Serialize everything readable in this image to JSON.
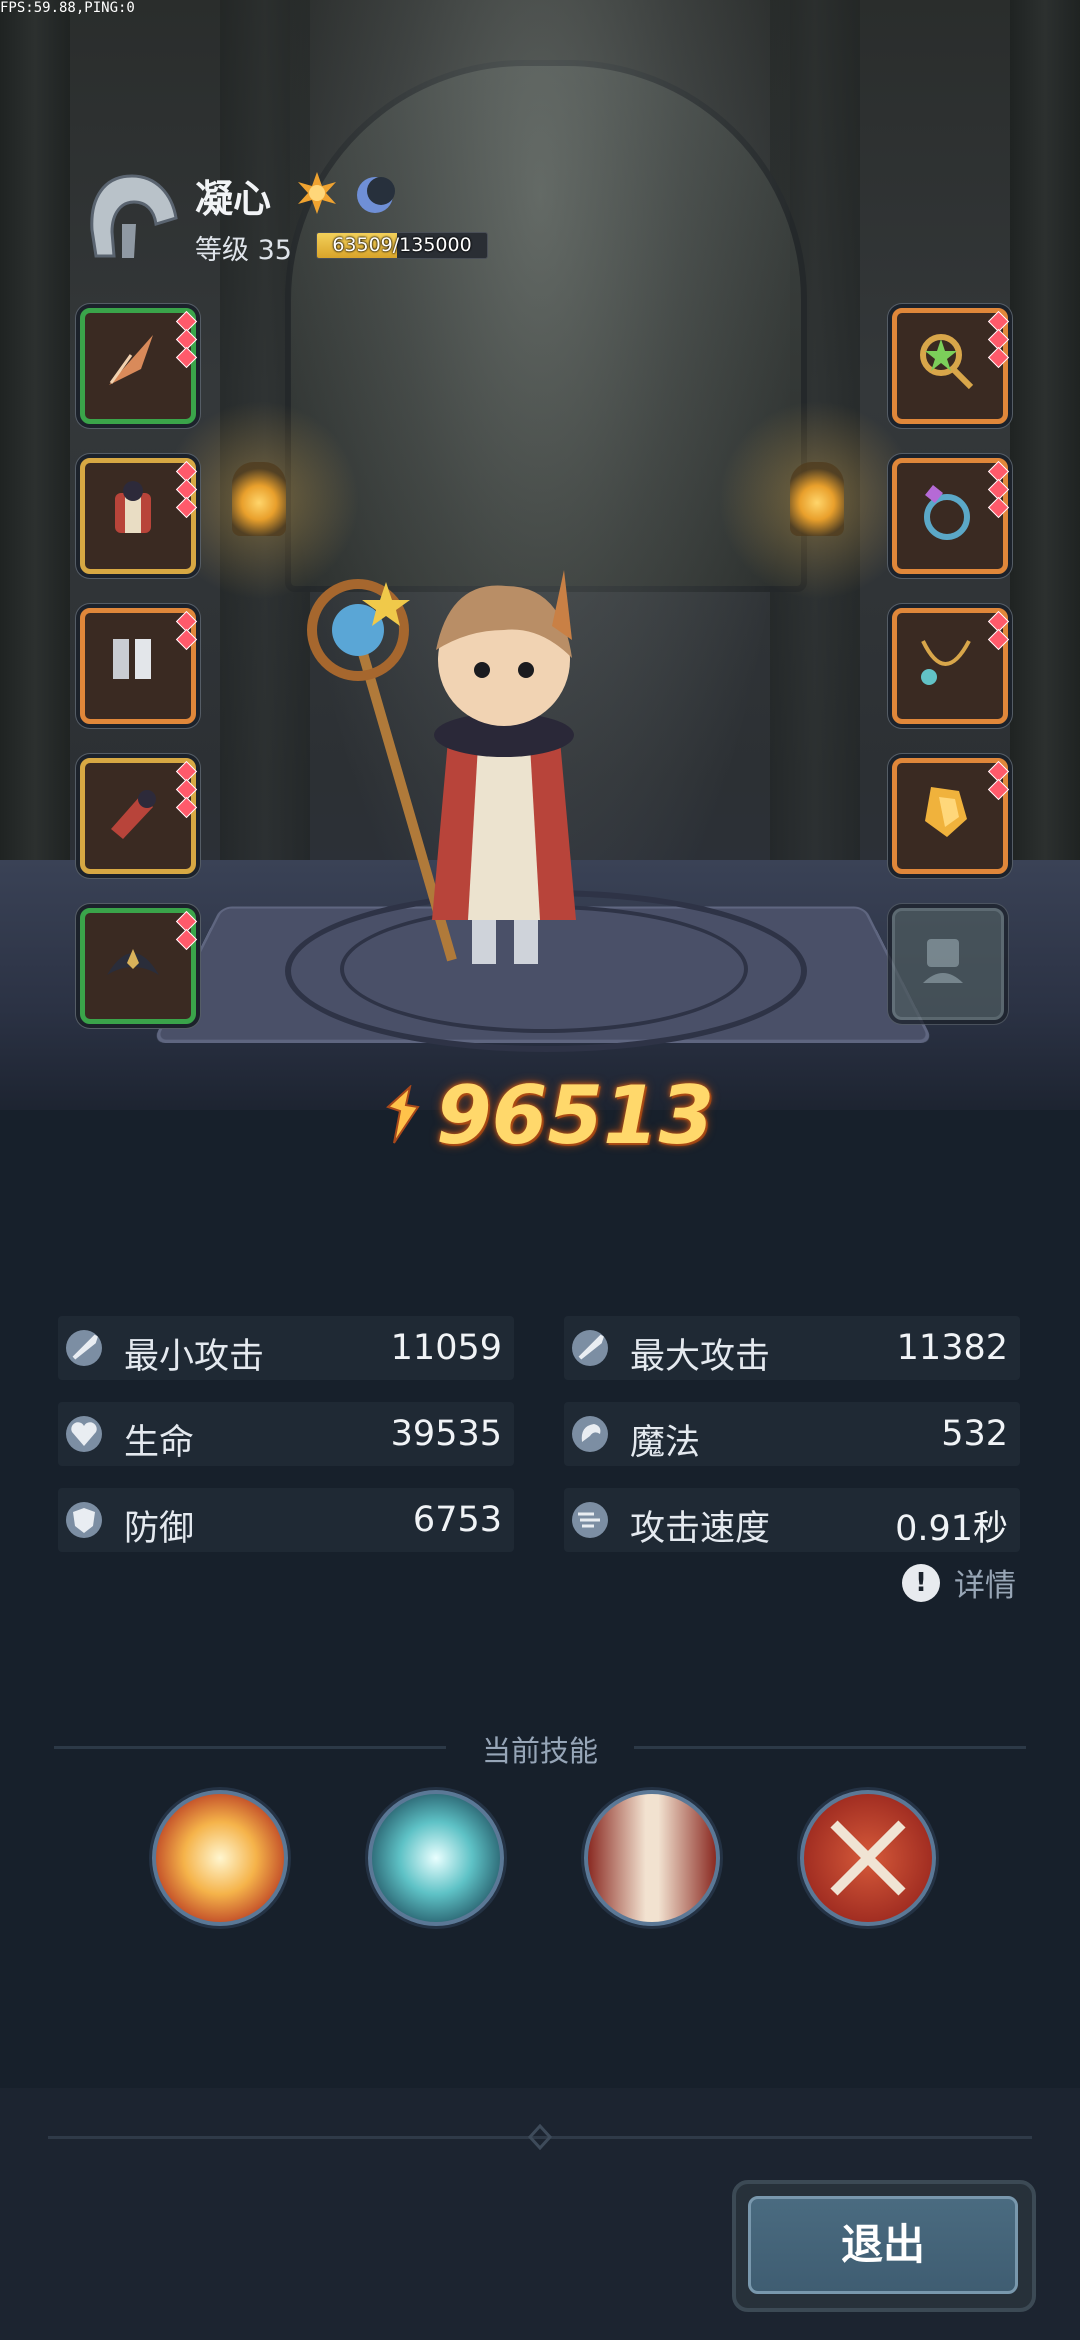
{
  "debug": {
    "fps_text": "FPS:59.88,PING:0"
  },
  "player": {
    "name": "凝心",
    "level_label": "等级 35",
    "xp_text": "63509/135000",
    "xp_fraction": 0.47
  },
  "power": {
    "value": "96513"
  },
  "equipment": {
    "left": [
      {
        "name": "weapon-feather-icon",
        "rarity": "green"
      },
      {
        "name": "robe-armor-icon",
        "rarity": "gold"
      },
      {
        "name": "boots-icon",
        "rarity": "orange"
      },
      {
        "name": "bracer-icon",
        "rarity": "gold"
      },
      {
        "name": "hood-icon",
        "rarity": "green"
      }
    ],
    "right": [
      {
        "name": "staff-orb-icon",
        "rarity": "orange"
      },
      {
        "name": "ring-icon",
        "rarity": "orange"
      },
      {
        "name": "necklace-icon",
        "rarity": "orange"
      },
      {
        "name": "crystal-icon",
        "rarity": "orange"
      },
      {
        "name": "empty-slot-icon",
        "rarity": "empty"
      }
    ]
  },
  "stats": [
    {
      "label": "最小攻击",
      "value": "11059",
      "icon": "sword-icon"
    },
    {
      "label": "最大攻击",
      "value": "11382",
      "icon": "sword-icon"
    },
    {
      "label": "生命",
      "value": "39535",
      "icon": "heart-icon"
    },
    {
      "label": "魔法",
      "value": "532",
      "icon": "magic-icon"
    },
    {
      "label": "防御",
      "value": "6753",
      "icon": "shield-icon"
    },
    {
      "label": "攻击速度",
      "value": "0.91秒",
      "icon": "speed-icon"
    }
  ],
  "detail_label": "详情",
  "skills": {
    "title": "当前技能",
    "items": [
      {
        "name": "explosion-skill-icon",
        "color": "#f5b34a"
      },
      {
        "name": "frost-orb-skill-icon",
        "color": "#5ec2c6"
      },
      {
        "name": "pillar-skill-icon",
        "color": "#c9443a"
      },
      {
        "name": "crossed-axes-skill-icon",
        "color": "#b83a2a"
      }
    ]
  },
  "exit_label": "退出"
}
